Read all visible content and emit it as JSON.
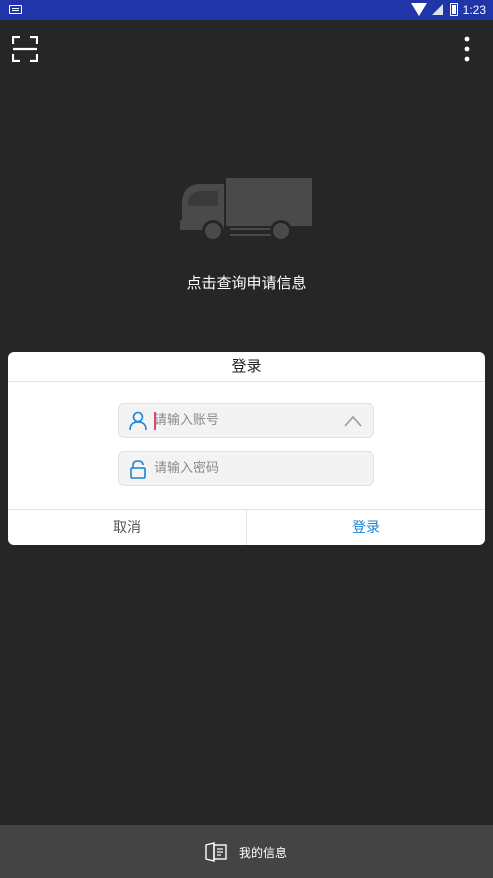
{
  "status_bar": {
    "time": "1:23",
    "icons": [
      "keyboard-icon",
      "wifi-icon",
      "signal-icon",
      "battery-icon"
    ]
  },
  "toolbar": {
    "scan_icon": "scan-icon",
    "menu_icon": "more-vert-icon"
  },
  "main": {
    "illustration": "truck-icon",
    "hint_text": "点击查询申请信息"
  },
  "login_dialog": {
    "title": "登录",
    "account_placeholder": "请输入账号",
    "password_placeholder": "请输入密码",
    "cancel_label": "取消",
    "login_label": "登录"
  },
  "bottom_nav": {
    "my_info_label": "我的信息",
    "my_info_icon": "id-card-icon"
  },
  "colors": {
    "background": "#262626",
    "status_bar": "#1f35a8",
    "accent": "#1a83d6",
    "bottom_bar": "#444444",
    "cursor": "#e0457b"
  }
}
